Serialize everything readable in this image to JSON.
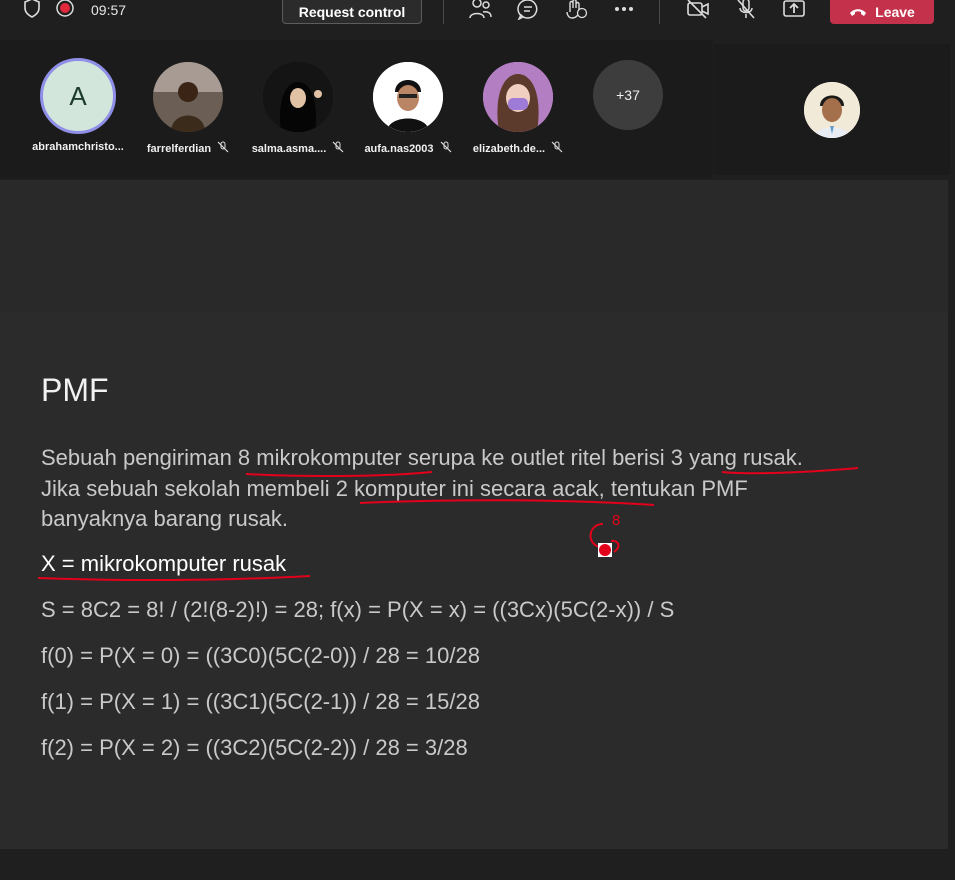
{
  "topbar": {
    "time": "09:57",
    "request_control_label": "Request control",
    "leave_label": "Leave",
    "icons": [
      "shield-icon",
      "record-icon",
      "people-icon",
      "chat-icon",
      "react-icon",
      "more-icon",
      "camera-off-icon",
      "mic-off-icon",
      "share-icon",
      "phone-icon"
    ]
  },
  "participants": [
    {
      "name": "abrahamchristo...",
      "initial": "A",
      "muted": false
    },
    {
      "name": "farrelferdian",
      "muted": true
    },
    {
      "name": "salma.asma....",
      "muted": true
    },
    {
      "name": "aufa.nas2003",
      "muted": true
    },
    {
      "name": "elizabeth.de...",
      "muted": true
    },
    {
      "name": "",
      "overflow": "+37"
    }
  ],
  "slide": {
    "title": "PMF",
    "lines": [
      "Sebuah pengiriman 8 mikrokomputer serupa ke outlet ritel berisi 3 yang rusak.",
      "Jika sebuah sekolah membeli 2 komputer ini secara acak, tentukan PMF",
      "banyaknya barang rusak.",
      "X = mikrokomputer rusak",
      "S = 8C2 = 8! / (2!(8-2)!) = 28; f(x) = P(X = x) = ((3Cx)(5C(2-x)) / S",
      "f(0) = P(X = 0) = ((3C0)(5C(2-0)) / 28 = 10/28",
      "f(1) = P(X = 1) = ((3C1)(5C(2-1)) / 28 = 15/28",
      "f(2) = P(X = 2) = ((3C2)(5C(2-2)) / 28 = 3/28"
    ],
    "annotation_text": "8",
    "ink_color": "#e3001b"
  }
}
